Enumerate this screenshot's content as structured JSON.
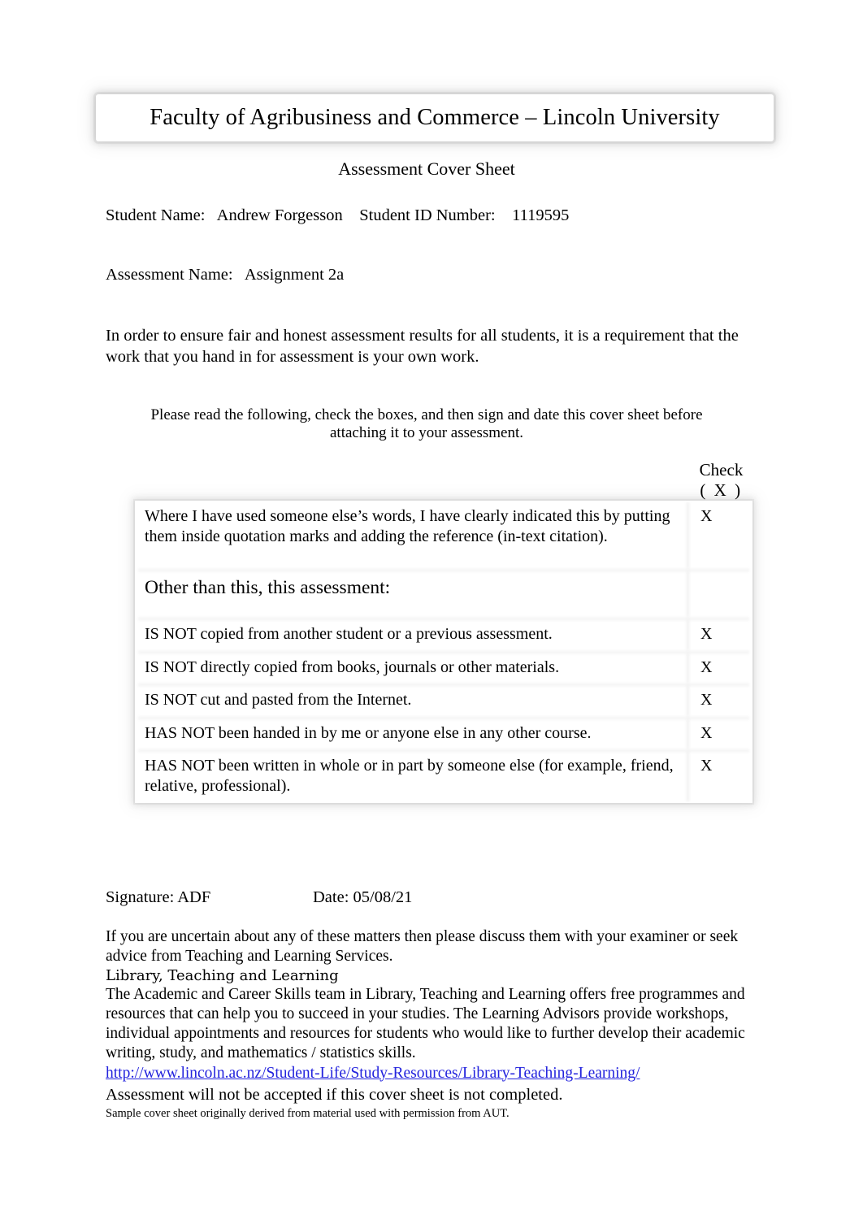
{
  "document": {
    "header_title": "Faculty of Agribusiness and Commerce – Lincoln University",
    "subtitle": "Assessment Cover Sheet"
  },
  "student": {
    "name_label": "Student Name:",
    "name_value": "Andrew Forgesson",
    "id_label": "Student ID Number:",
    "id_value": "1119595",
    "line": "Student Name:   Andrew Forgesson    Student ID Number:    1119595",
    "assessment_label": "Assessment Name:",
    "assessment_value": "Assignment 2a",
    "assessment_line": "Assessment Name:   Assignment 2a"
  },
  "intro": {
    "paragraph": "In order to ensure fair and honest assessment results for all students, it is a requirement that the work that you hand in for assessment is your own work.",
    "instruction": "Please read the following, check the boxes, and then sign and date this cover sheet before attaching it to your assessment."
  },
  "table": {
    "check_header_line1": "Check",
    "check_header_line2": "(  X  )",
    "rows": [
      {
        "text": "Where I have used someone else’s words, I have clearly indicated this by putting them inside quotation marks and adding the reference (in-text citation).",
        "check": "X"
      },
      {
        "text": "Other than this, this assessment:",
        "check": ""
      },
      {
        "text": "IS NOT copied from another student or a previous assessment.",
        "check": "X"
      },
      {
        "text": "IS NOT directly copied from books, journals or other materials.",
        "check": "X"
      },
      {
        "text": "IS NOT cut and pasted from the Internet.",
        "check": "X"
      },
      {
        "text": "HAS NOT been handed in by me or anyone else in any other course.",
        "check": "X"
      },
      {
        "text": "HAS NOT been written in whole or in part by someone else (for example, friend, relative, professional).",
        "check": "X"
      }
    ]
  },
  "signature": {
    "signature_text": "Signature: ADF",
    "date_text": "Date: 05/08/21"
  },
  "footer": {
    "uncertain": "If you are uncertain about any of these matters then please discuss them with your examiner or seek advice from Teaching and Learning Services.",
    "service_name": "Library, Teaching and Learning",
    "description": "The Academic and Career Skills team in Library, Teaching and Learning offers free programmes and resources that can help you to succeed in your studies. The Learning Advisors provide workshops, individual appointments and resources for students who would like to further develop their academic writing, study, and mathematics / statistics skills.",
    "link": "http://www.lincoln.ac.nz/Student-Life/Study-Resources/Library-Teaching-Learning/",
    "not_accepted": "Assessment will not be accepted if this cover sheet is not completed.",
    "fineprint": "Sample cover sheet originally derived from material used with permission from AUT."
  },
  "colors": {
    "link": "#2222dd",
    "text": "#000000",
    "page_background": "#ffffff"
  }
}
